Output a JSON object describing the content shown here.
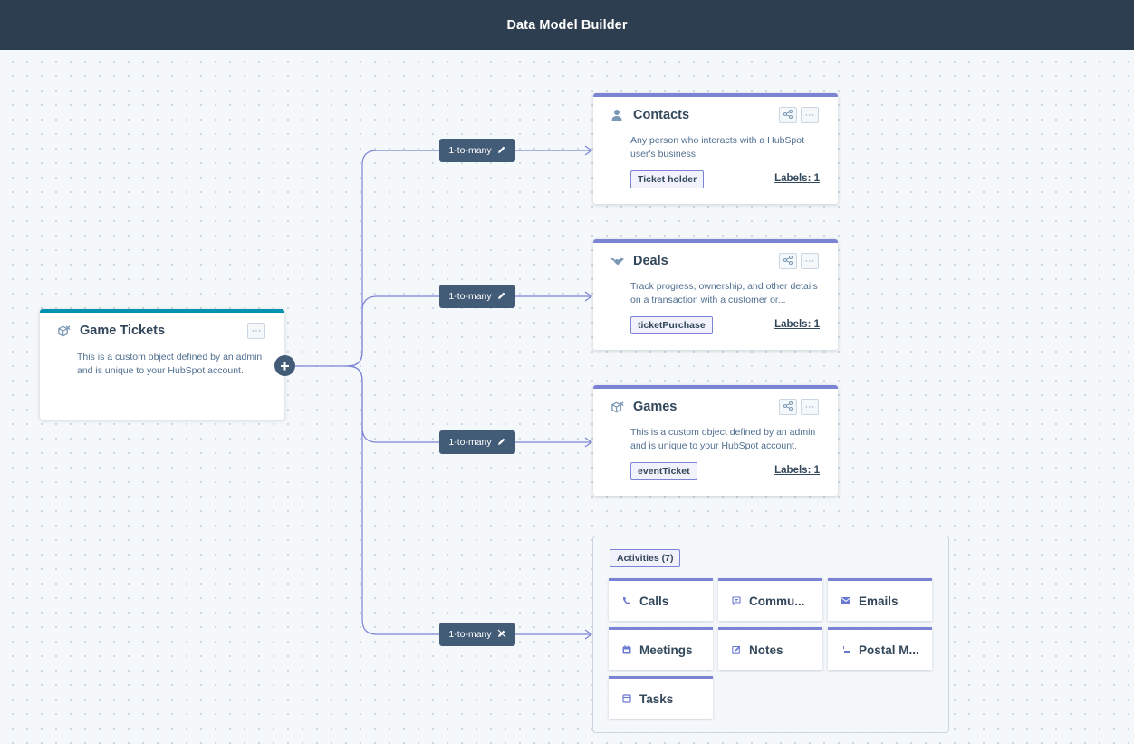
{
  "header": {
    "title": "Data Model Builder"
  },
  "source": {
    "title": "Game Tickets",
    "icon": "custom-object-icon",
    "description_line1": "This is a custom object defined by an admin",
    "description_line2": "and is unique to your HubSpot account.",
    "more_label": "···"
  },
  "add_button": {
    "label": "+"
  },
  "relationships": [
    {
      "label": "1-to-many",
      "icon": "pencil-icon"
    },
    {
      "label": "1-to-many",
      "icon": "pencil-icon"
    },
    {
      "label": "1-to-many",
      "icon": "pencil-icon"
    },
    {
      "label": "1-to-many",
      "icon": "edit-disabled-icon"
    }
  ],
  "objects": [
    {
      "title": "Contacts",
      "icon": "person-icon",
      "description_line1": "Any person who interacts with a HubSpot",
      "description_line2": "user's business.",
      "tag": "Ticket holder",
      "labels": "Labels: 1",
      "more_label": "···"
    },
    {
      "title": "Deals",
      "icon": "handshake-icon",
      "description_line1": "Track progress, ownership, and other details",
      "description_line2": "on a transaction with a customer or...",
      "tag": "ticketPurchase",
      "labels": "Labels: 1",
      "more_label": "···"
    },
    {
      "title": "Games",
      "icon": "custom-object-icon",
      "description_line1": "This is a custom object defined by an admin",
      "description_line2": "and is unique to your HubSpot account.",
      "tag": "eventTicket",
      "labels": "Labels: 1",
      "more_label": "···"
    }
  ],
  "activities": {
    "tag": "Activities (7)",
    "items": [
      {
        "label": "Calls",
        "icon": "phone-icon"
      },
      {
        "label": "Commu...",
        "icon": "chat-icon"
      },
      {
        "label": "Emails",
        "icon": "email-icon"
      },
      {
        "label": "Meetings",
        "icon": "calendar-icon"
      },
      {
        "label": "Notes",
        "icon": "note-icon"
      },
      {
        "label": "Postal M...",
        "icon": "postal-icon"
      },
      {
        "label": "Tasks",
        "icon": "task-icon"
      }
    ]
  },
  "colors": {
    "header_bg": "#2d3e50",
    "source_accent": "#0091ae",
    "object_accent": "#7b83d4",
    "pill_bg": "#425b76",
    "connector": "#7b83d4"
  }
}
